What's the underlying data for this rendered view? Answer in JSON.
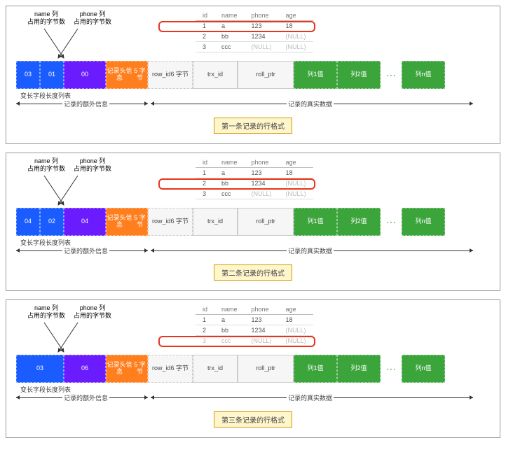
{
  "labels": {
    "name_col": "name 列\n占用的字节数",
    "phone_col": "phone 列\n占用的字节数",
    "varlen_list": "变长字段长度列表",
    "extra_info": "记录的额外信息",
    "real_data": "记录的真实数据"
  },
  "table": {
    "headers": [
      "id",
      "name",
      "phone",
      "age"
    ],
    "rows": [
      {
        "id": "1",
        "name": "a",
        "phone": "123",
        "age": "18"
      },
      {
        "id": "2",
        "name": "bb",
        "phone": "1234",
        "age": "(NULL)"
      },
      {
        "id": "3",
        "name": "ccc",
        "phone": "(NULL)",
        "age": "(NULL)"
      }
    ]
  },
  "common_blocks": {
    "header": "记录头信息\n5 字节",
    "row_id": "row_id\n6 字节",
    "trx_id": "trx_id",
    "roll_ptr": "roll_ptr",
    "col1": "列1值",
    "col2": "列2值",
    "coln": "列n值"
  },
  "panels": [
    {
      "blue": [
        "03",
        "01"
      ],
      "purple": "00",
      "caption": "第一条记录的行格式",
      "highlight_row": 0
    },
    {
      "blue": [
        "04",
        "02"
      ],
      "purple": "04",
      "caption": "第二条记录的行格式",
      "highlight_row": 1
    },
    {
      "blue": [
        "03"
      ],
      "purple": "06",
      "caption": "第三条记录的行格式",
      "highlight_row": 2,
      "grey_out_row": 2
    }
  ]
}
